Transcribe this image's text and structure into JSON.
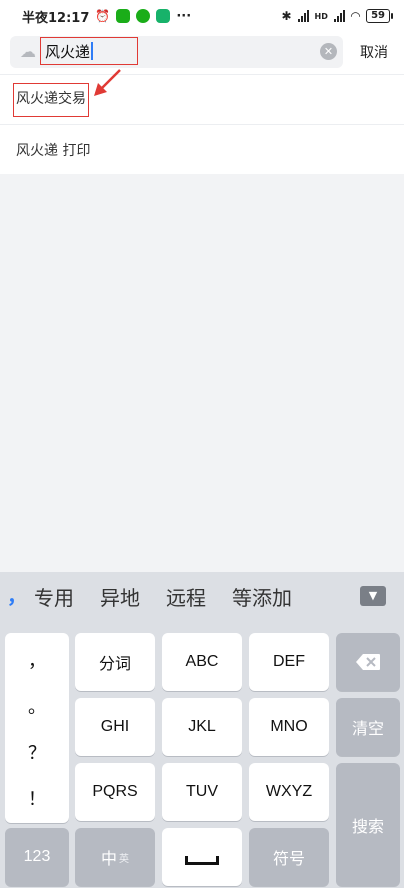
{
  "status": {
    "time": "半夜12:17",
    "battery": "59",
    "more": "···",
    "network": "HD"
  },
  "search": {
    "value": "风火递",
    "cancel_label": "取消",
    "clear": "✕"
  },
  "suggestions": [
    {
      "label": "风火递交易"
    },
    {
      "label": "风火递 打印"
    }
  ],
  "keyboard": {
    "candidate_punct": "，",
    "candidates": [
      "专用",
      "异地",
      "远程",
      "等添加"
    ],
    "punct": [
      "，",
      "。",
      "？",
      "！"
    ],
    "row1": [
      "分词",
      "ABC",
      "DEF"
    ],
    "row2": [
      "GHI",
      "JKL",
      "MNO"
    ],
    "row3": [
      "PQRS",
      "TUV",
      "WXYZ"
    ],
    "clear_label": "清空",
    "search_label": "搜索",
    "num_label": "123",
    "zh_label": "中",
    "zh_sub": "英",
    "symbol_label": "符号"
  },
  "colors": {
    "highlight": "#e03a35",
    "accent": "#2f7df6"
  }
}
